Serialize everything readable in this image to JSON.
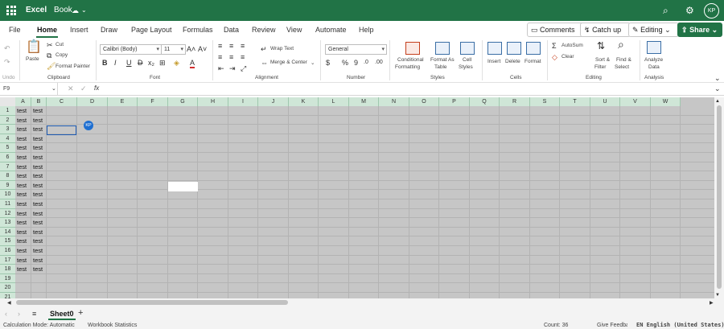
{
  "app": {
    "name": "Excel",
    "doc_name": "Book",
    "user_initials": "KP"
  },
  "tabs": [
    "File",
    "Home",
    "Insert",
    "Draw",
    "Page Layout",
    "Formulas",
    "Data",
    "Review",
    "View",
    "Automate",
    "Help"
  ],
  "active_tab": "Home",
  "top_buttons": {
    "comments": "Comments",
    "catch_up": "Catch up",
    "editing": "Editing",
    "share": "Share"
  },
  "ribbon": {
    "undo": "Undo",
    "paste": "Paste",
    "cut": "Cut",
    "copy": "Copy",
    "format_painter": "Format Painter",
    "clipboard_group": "Clipboard",
    "font_name": "Calibri (Body)",
    "font_size": "11",
    "bold": "B",
    "italic": "I",
    "underline": "U",
    "strike": "D",
    "font_group": "Font",
    "wrap_text": "Wrap Text",
    "merge_center": "Merge & Center",
    "alignment_group": "Alignment",
    "number_format": "General",
    "number_group": "Number",
    "conditional_formatting": [
      "Conditional",
      "Formatting"
    ],
    "format_as_table": [
      "Format As",
      "Table"
    ],
    "cell_styles": [
      "Cell",
      "Styles"
    ],
    "styles_group": "Styles",
    "insert": "Insert",
    "delete": "Delete",
    "format": "Format",
    "cells_group": "Cells",
    "autosum": "AutoSum",
    "clear": "Clear",
    "sort_filter": [
      "Sort &",
      "Filter"
    ],
    "find_select": [
      "Find &",
      "Select"
    ],
    "editing_group": "Editing",
    "analyze_data": [
      "Analyze",
      "Data"
    ],
    "analysis_group": "Analysis"
  },
  "formula_bar": {
    "name_box": "F9",
    "fx": "fx",
    "value": ""
  },
  "grid": {
    "columns": [
      "A",
      "B",
      "C",
      "D",
      "E",
      "F",
      "G",
      "H",
      "I",
      "J",
      "K",
      "L",
      "M",
      "N",
      "O",
      "P",
      "Q",
      "R",
      "S",
      "T",
      "U",
      "V",
      "W"
    ],
    "rows": [
      "1",
      "2",
      "3",
      "4",
      "5",
      "6",
      "7",
      "8",
      "9",
      "10",
      "11",
      "12",
      "13",
      "14",
      "15",
      "16",
      "17",
      "18",
      "19",
      "20",
      "21"
    ],
    "cells": [
      [
        "test",
        "test"
      ],
      [
        "test",
        "test"
      ],
      [
        "test",
        "test"
      ],
      [
        "test",
        "test"
      ],
      [
        "test",
        "test"
      ],
      [
        "test",
        "test"
      ],
      [
        "test",
        "test"
      ],
      [
        "test",
        "test"
      ],
      [
        "test",
        "test"
      ],
      [
        "test",
        "test"
      ],
      [
        "test",
        "test"
      ],
      [
        "test",
        "test"
      ],
      [
        "test",
        "test"
      ],
      [
        "test",
        "test"
      ],
      [
        "test",
        "test"
      ],
      [
        "test",
        "test"
      ],
      [
        "test",
        "test"
      ],
      [
        "test",
        "test"
      ]
    ],
    "presence_initials": "KP"
  },
  "sheets": {
    "active": "Sheet0",
    "add": "+"
  },
  "status": {
    "calc_mode": "Calculation Mode: Automatic",
    "workbook_stats": "Workbook Statistics",
    "count": "Count: 36",
    "feedback": "Give Feedback",
    "language": "EN English (United States)"
  },
  "colors": {
    "brand_green": "#217346",
    "header_green": "#cfe6d7",
    "selection_blue": "#1e5bb3",
    "sheet_gray": "#c6c6c6"
  }
}
